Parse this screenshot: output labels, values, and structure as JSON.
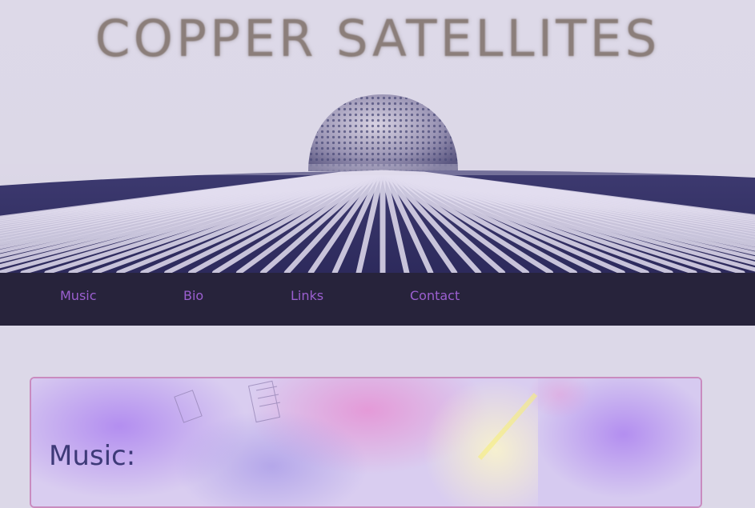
{
  "header": {
    "title": "COPPER SATELLITES",
    "banner_image": "ribbed-dome-landscape-artwork"
  },
  "nav": {
    "items": [
      {
        "label": "Music"
      },
      {
        "label": "Bio"
      },
      {
        "label": "Links"
      },
      {
        "label": "Contact"
      }
    ],
    "link_color": "#9b5fd0",
    "bar_color": "#27233b"
  },
  "content": {
    "heading": "Music:",
    "background_image": "pastel-purple-abstract-texture",
    "border_color": "#c98bbf"
  },
  "colors": {
    "page_background": "#dcd8e8",
    "heading_color": "#3e3a78"
  }
}
